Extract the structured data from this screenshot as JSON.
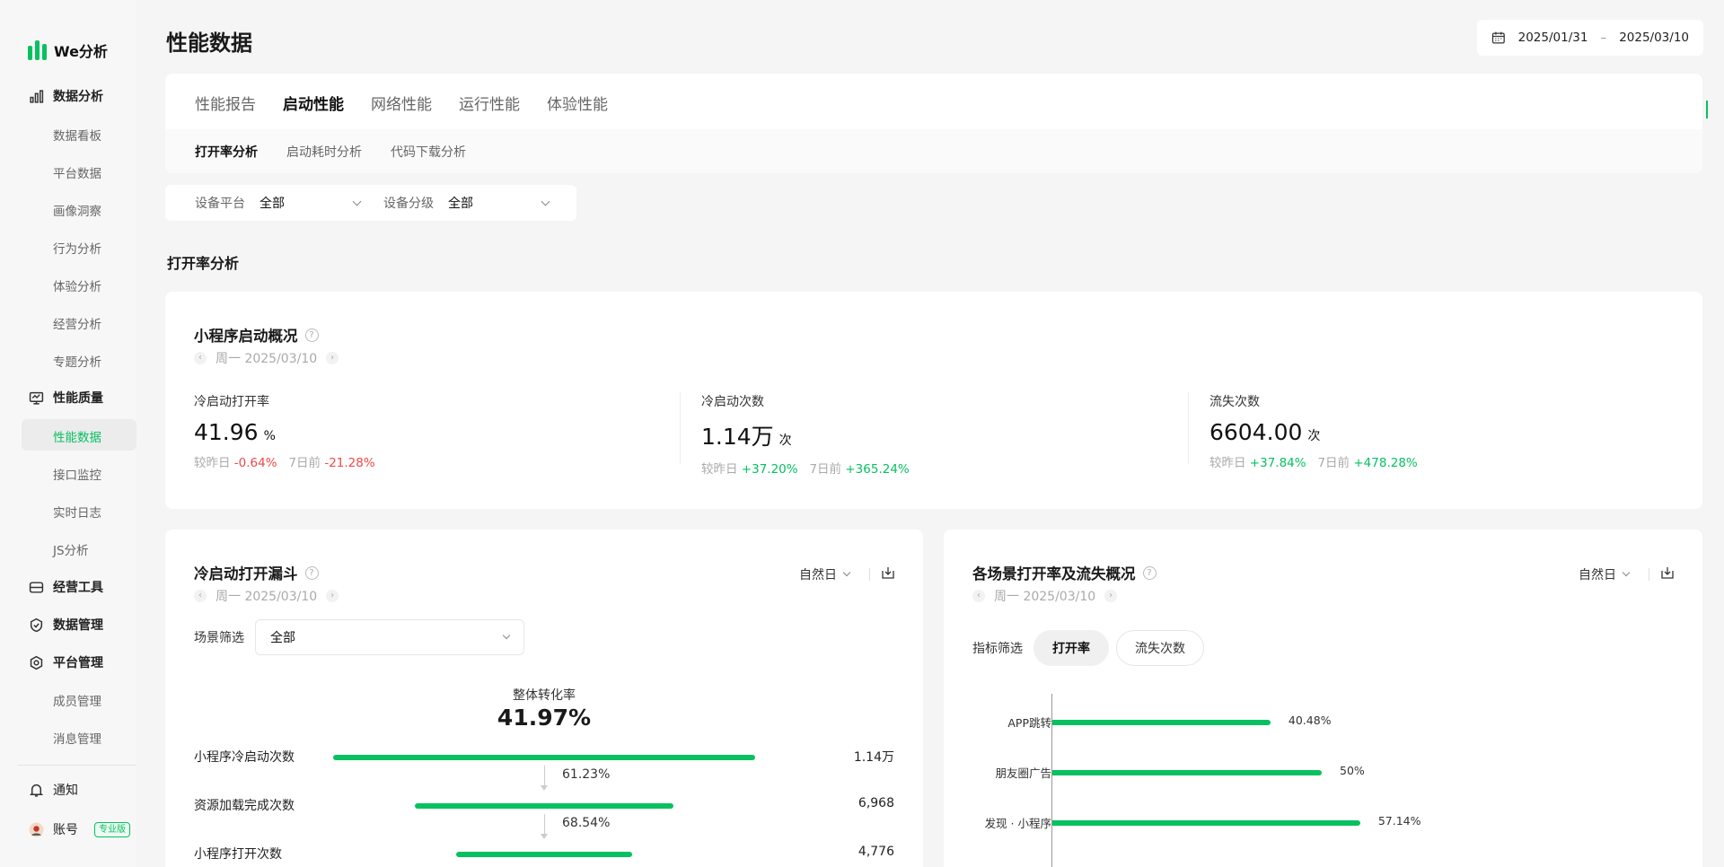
{
  "app": {
    "logo_text": "We分析"
  },
  "sidebar": {
    "groups": [
      {
        "label": "数据分析"
      },
      {
        "label": "性能质量"
      },
      {
        "label": "经营工具"
      },
      {
        "label": "数据管理"
      },
      {
        "label": "平台管理"
      }
    ],
    "data_items": [
      "数据看板",
      "平台数据",
      "画像洞察",
      "行为分析",
      "体验分析",
      "经营分析",
      "专题分析"
    ],
    "perf_items": [
      "性能数据",
      "接口监控",
      "实时日志",
      "JS分析"
    ],
    "platform_items": [
      "成员管理",
      "消息管理"
    ],
    "notify_label": "通知",
    "account_label": "账号",
    "account_badge": "专业版"
  },
  "header": {
    "title": "性能数据",
    "date_start": "2025/01/31",
    "date_sep": "–",
    "date_end": "2025/03/10"
  },
  "tabs": [
    "性能报告",
    "启动性能",
    "网络性能",
    "运行性能",
    "体验性能"
  ],
  "subtabs": [
    "打开率分析",
    "启动耗时分析",
    "代码下载分析"
  ],
  "filters": {
    "platform_label": "设备平台",
    "platform_value": "全部",
    "level_label": "设备分级",
    "level_value": "全部"
  },
  "section_title": "打开率分析",
  "overview": {
    "title": "小程序启动概况",
    "date": "周一 2025/03/10",
    "metrics": [
      {
        "label": "冷启动打开率",
        "value": "41.96",
        "unit": "%",
        "cmp1_label": "较昨日",
        "cmp1": "-0.64%",
        "cmp2_label": "7日前",
        "cmp2": "-21.28%"
      },
      {
        "label": "冷启动次数",
        "value": "1.14万",
        "unit": "次",
        "cmp1_label": "较昨日",
        "cmp1": "+37.20%",
        "cmp2_label": "7日前",
        "cmp2": "+365.24%"
      },
      {
        "label": "流失次数",
        "value": "6604.00",
        "unit": "次",
        "cmp1_label": "较昨日",
        "cmp1": "+37.84%",
        "cmp2_label": "7日前",
        "cmp2": "+478.28%"
      }
    ]
  },
  "funnel": {
    "title": "冷启动打开漏斗",
    "date": "周一 2025/03/10",
    "period": "自然日",
    "scene_label": "场景筛选",
    "scene_value": "全部",
    "overall_label": "整体转化率",
    "overall_value": "41.97%",
    "steps": [
      {
        "label": "小程序冷启动次数",
        "value": "1.14万",
        "count": 11400
      },
      {
        "label": "资源加载完成次数",
        "value": "6,968",
        "count": 6968
      },
      {
        "label": "小程序打开次数",
        "value": "4,776",
        "count": 4776
      }
    ],
    "rates": [
      "61.23%",
      "68.54%"
    ]
  },
  "scenes": {
    "title": "各场景打开率及流失概况",
    "date": "周一 2025/03/10",
    "period": "自然日",
    "metric_label": "指标筛选",
    "metric_options": [
      "打开率",
      "流失次数"
    ],
    "active_metric": "打开率"
  },
  "chart_data": {
    "type": "bar",
    "orientation": "horizontal",
    "categories": [
      "APP跳转",
      "朋友圈广告",
      "发现 · 小程序"
    ],
    "values": [
      40.48,
      50,
      57.14
    ],
    "labels": [
      "40.48%",
      "50%",
      "57.14%"
    ],
    "xlim": [
      0,
      80
    ]
  },
  "colors": {
    "accent": "#07c160",
    "negative": "#f04848"
  }
}
